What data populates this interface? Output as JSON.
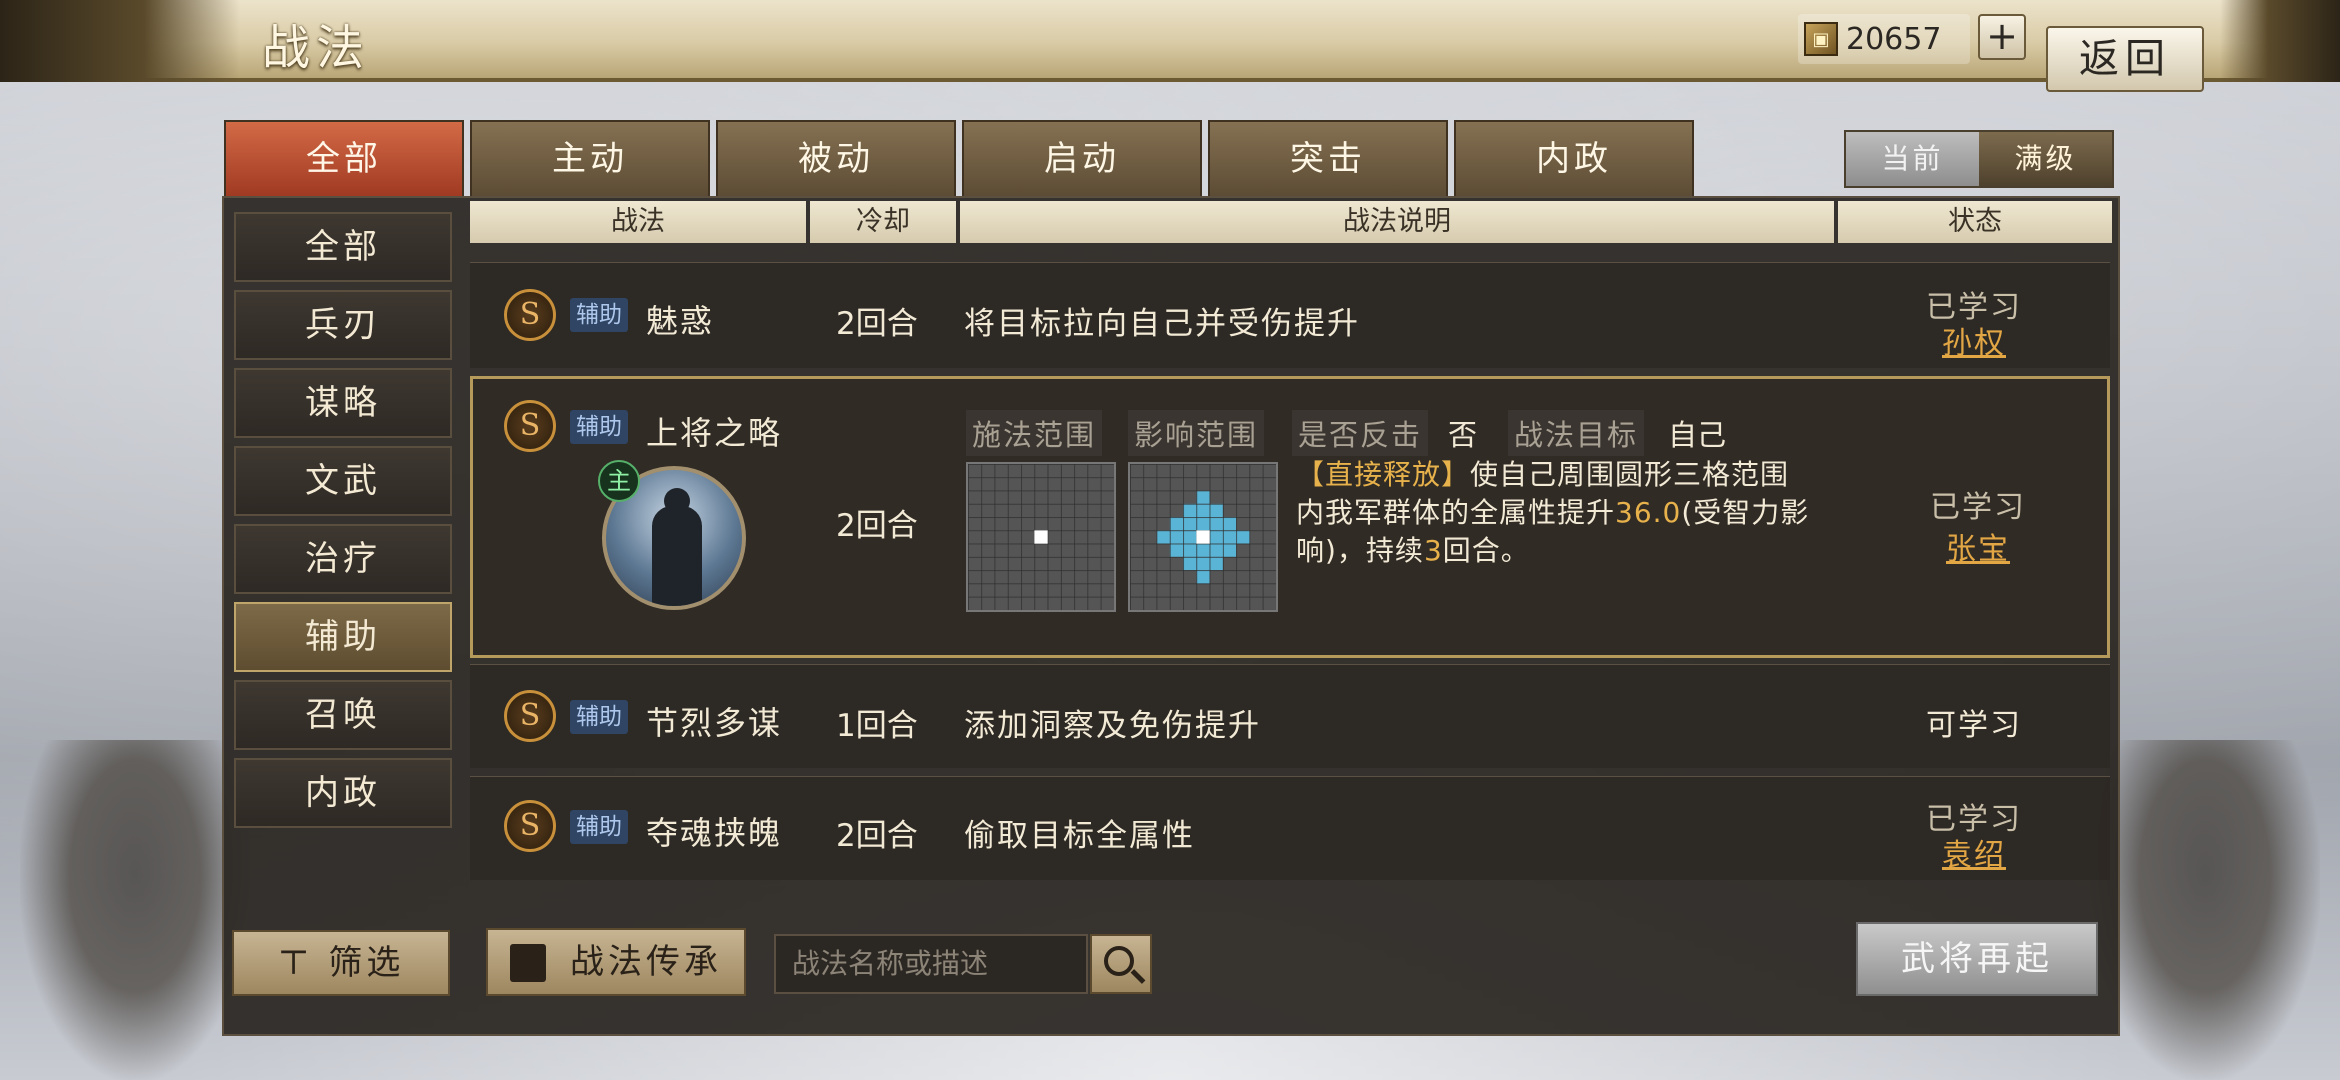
{
  "header": {
    "title": "战法",
    "currency_value": "20657",
    "plus_label": "+",
    "back_label": "返回"
  },
  "tabs": [
    {
      "label": "全部",
      "active": true
    },
    {
      "label": "主动",
      "active": false
    },
    {
      "label": "被动",
      "active": false
    },
    {
      "label": "启动",
      "active": false
    },
    {
      "label": "突击",
      "active": false
    },
    {
      "label": "内政",
      "active": false
    }
  ],
  "level_toggle": {
    "current": "当前",
    "max": "满级",
    "selected": "满级"
  },
  "sidebar": {
    "items": [
      {
        "label": "全部"
      },
      {
        "label": "兵刃"
      },
      {
        "label": "谋略"
      },
      {
        "label": "文武"
      },
      {
        "label": "治疗"
      },
      {
        "label": "辅助",
        "active": true
      },
      {
        "label": "召唤"
      },
      {
        "label": "内政"
      }
    ],
    "filter_label": "筛选"
  },
  "table": {
    "headers": {
      "skill": "战法",
      "cooldown": "冷却",
      "description": "战法说明",
      "status": "状态"
    },
    "rows": [
      {
        "grade": "S",
        "tag": "辅助",
        "name": "魅惑",
        "cooldown": "2回合",
        "description": "将目标拉向自己并受伤提升",
        "status": "已学习",
        "general": "孙权"
      },
      {
        "grade": "S",
        "tag": "辅助",
        "name": "上将之略",
        "cooldown": "2回合",
        "status": "已学习",
        "general": "张宝",
        "main_badge": "主",
        "cast_range_label": "施法范围",
        "effect_range_label": "影响范围",
        "counter_label": "是否反击",
        "counter_value": "否",
        "target_label": "战法目标",
        "target_value": "自己",
        "detail_prefix": "【直接释放】",
        "detail_part1": "使自己周围圆形三格范围内我军群体的全属性提升",
        "detail_num1": "36.0",
        "detail_part2": "(受智力影响)，持续",
        "detail_num2": "3",
        "detail_part3": "回合。"
      },
      {
        "grade": "S",
        "tag": "辅助",
        "name": "节烈多谋",
        "cooldown": "1回合",
        "description": "添加洞察及免伤提升",
        "status": "可学习",
        "general": ""
      },
      {
        "grade": "S",
        "tag": "辅助",
        "name": "夺魂挟魄",
        "cooldown": "2回合",
        "description": "偷取目标全属性",
        "status": "已学习",
        "general": "袁绍"
      }
    ]
  },
  "bottom": {
    "inherit_label": "战法传承",
    "search_placeholder": "战法名称或描述",
    "revive_label": "武将再起"
  },
  "colors": {
    "accent_gold": "#e7b14b",
    "tab_active": "#c2543a",
    "grid_effect": "#5ab4d6"
  }
}
